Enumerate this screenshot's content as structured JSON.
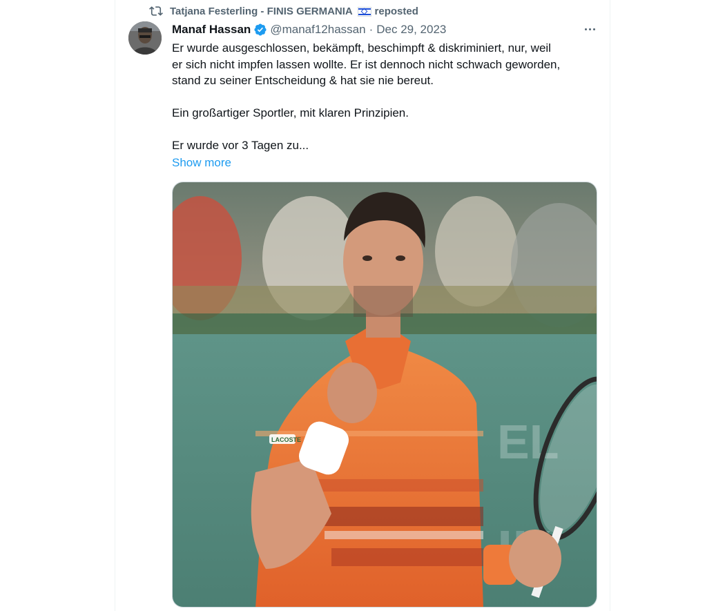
{
  "repost": {
    "icon": "repost-icon",
    "reposter": "Tatjana Festerling - FINIS GERMANIA",
    "flag": "israel-flag-icon",
    "suffix": "reposted"
  },
  "tweet": {
    "author_name": "Manaf Hassan",
    "verified_icon": "verified-badge-icon",
    "handle": "@manaf12hassan",
    "separator": "·",
    "date": "Dec 29, 2023",
    "more_icon": "more-options-icon",
    "text": {
      "line1": "Er wurde ausgeschlossen, bekämpft, beschimpft & diskriminiert, nur, weil",
      "line2": "er sich nicht impfen lassen wollte. Er ist dennoch nicht schwach geworden,",
      "line3": "stand zu seiner Entscheidung & hat sie nie bereut.",
      "line4": "Ein großartiger Sportler, mit klaren Prinzipien.",
      "line5": "Er wurde vor 3 Tagen zu..."
    },
    "show_more": "Show more",
    "media": {
      "wristband_text": "LACOSTE"
    }
  },
  "colors": {
    "link": "#1d9bf0",
    "muted": "#536471",
    "shirt": "#ee7a3a"
  }
}
